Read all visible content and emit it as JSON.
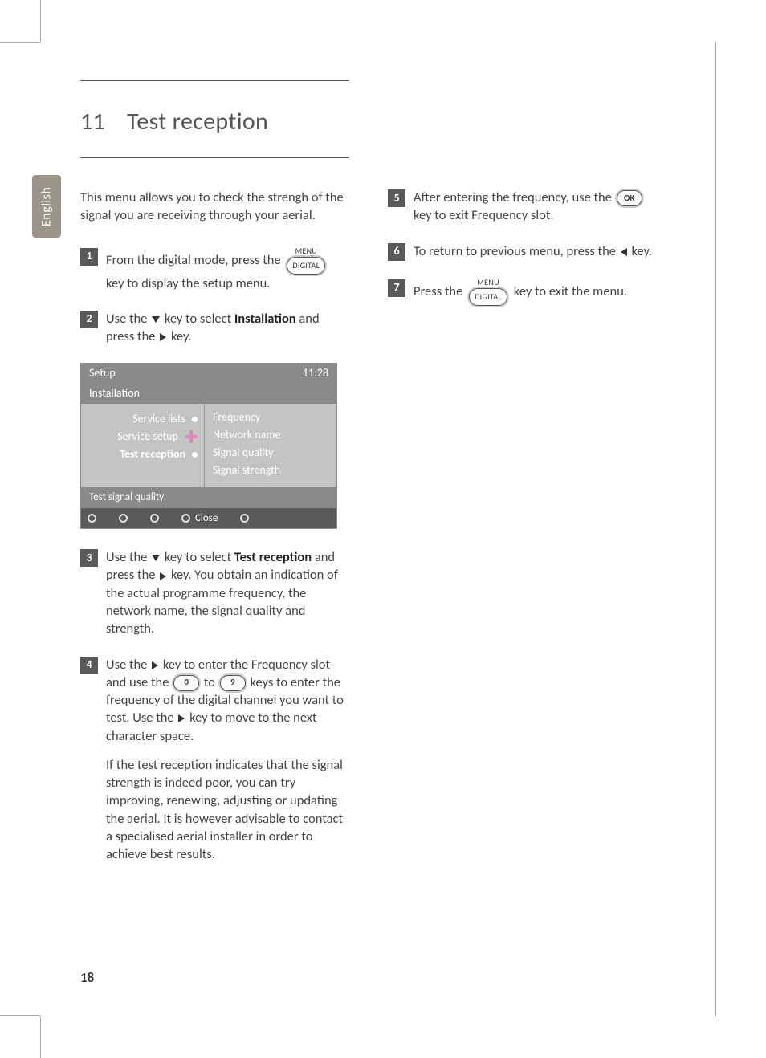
{
  "page": {
    "number": "18",
    "language_tab": "English"
  },
  "heading": {
    "number": "11",
    "title": "Test reception"
  },
  "intro": "This menu allows you to check the strengh of the signal you are receiving through your aerial.",
  "keys": {
    "menu_label": "MENU",
    "digital_label": "DIGITAL",
    "ok_label": "OK",
    "zero": "0",
    "nine": "9"
  },
  "steps_left": {
    "s1a": "From the digital mode, press the",
    "s1b": "key to display the setup menu.",
    "s2a": "Use the",
    "s2b": "key to select",
    "s2c": "Installation",
    "s2d": "and press the",
    "s2e": "key.",
    "s3a": "Use the",
    "s3b": "key to select",
    "s3c": "Test reception",
    "s3d": "and press the",
    "s3e": "key. You obtain an indication of the actual programme frequency, the network name, the signal quality and strength.",
    "s4a": "Use the",
    "s4b": "key to enter the Frequency slot and use the",
    "s4c": "to",
    "s4d": "keys to enter the frequency of the digital channel you want to test. Use the",
    "s4e": "key to move to the next character space.",
    "s4note": "If the test reception indicates that the signal strength is indeed poor, you can try improving, renewing, adjusting or updating the aerial. It is however advisable to contact a specialised aerial installer in order to achieve best results."
  },
  "steps_right": {
    "s5a": "After entering the frequency, use the",
    "s5b": "key to exit Frequency slot.",
    "s6a": "To return to previous menu, press the",
    "s6b": "key.",
    "s7a": "Press the",
    "s7b": "key to exit the menu."
  },
  "osd": {
    "title": "Setup",
    "time": "11:28",
    "subtitle": "Installation",
    "left_items": [
      "Service lists",
      "Service setup",
      "Test reception"
    ],
    "right_items": [
      "Frequency",
      "Network name",
      "Signal quality",
      "Signal strength"
    ],
    "hint": "Test signal quality",
    "close": "Close"
  }
}
